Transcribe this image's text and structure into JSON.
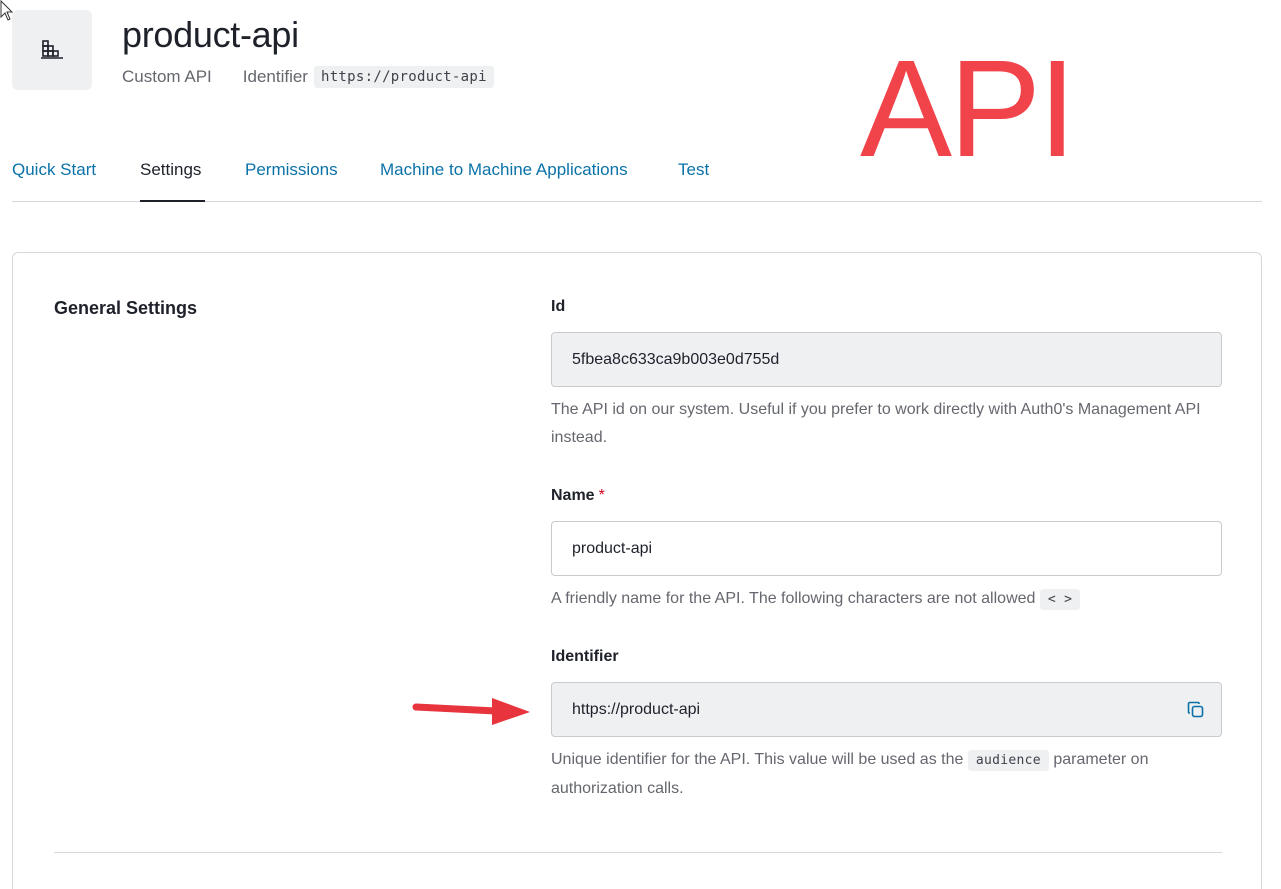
{
  "header": {
    "title": "product-api",
    "type": "Custom API",
    "identifier_label": "Identifier",
    "identifier_value": "https://product-api",
    "icon": "api-building-icon"
  },
  "annotation": {
    "overlay_text": "API",
    "overlay_color": "#f1434a",
    "arrow_color": "#e8343c"
  },
  "tabs": [
    {
      "label": "Quick Start",
      "active": false
    },
    {
      "label": "Settings",
      "active": true
    },
    {
      "label": "Permissions",
      "active": false
    },
    {
      "label": "Machine to Machine Applications",
      "active": false
    },
    {
      "label": "Test",
      "active": false
    }
  ],
  "settings": {
    "section_title": "General Settings",
    "id_field": {
      "label": "Id",
      "value": "5fbea8c633ca9b003e0d755d",
      "help": "The API id on our system. Useful if you prefer to work directly with Auth0's Management API instead."
    },
    "name_field": {
      "label": "Name",
      "required_mark": "*",
      "value": "product-api",
      "help": "A friendly name for the API. The following characters are not allowed",
      "disallowed_chars": "< >"
    },
    "identifier_field": {
      "label": "Identifier",
      "value": "https://product-api",
      "copy_icon": "copy-icon",
      "help_before": "Unique identifier for the API. This value will be used as the",
      "help_code": "audience",
      "help_after": "parameter on authorization calls."
    }
  },
  "colors": {
    "link": "#0a72a8",
    "text": "#1e212a",
    "muted": "#65676e",
    "readonly_bg": "#eff0f2"
  }
}
